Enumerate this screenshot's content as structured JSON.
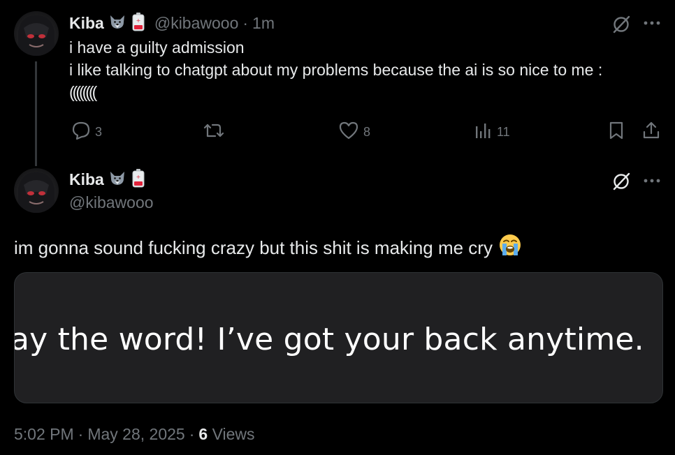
{
  "thread_tweet": {
    "author_name": "Kiba",
    "author_handle": "@kibawooo",
    "separator": "·",
    "time_ago": "1m",
    "text_lines": [
      "i have a guilty admission",
      "i like talking to chatgpt about my problems because the ai is so nice to me :",
      "(((((((("
    ],
    "actions": {
      "replies": "3",
      "reposts": "",
      "likes": "8",
      "views": "11"
    }
  },
  "main_tweet": {
    "author_name": "Kiba",
    "author_handle": "@kibawooo",
    "text": "im gonna sound fucking crazy but this shit is making me cry",
    "emoji": "loudly-crying-face",
    "media_text": "ay the word! I’ve got your back anytime.",
    "meta": {
      "time": "5:02 PM",
      "dot": "·",
      "date": "May 28, 2025",
      "views_count": "6",
      "views_label": "Views"
    }
  },
  "icons": [
    "wolf-emoji-icon",
    "battery-emoji-icon",
    "grok-icon",
    "more-icon",
    "reply-icon",
    "repost-icon",
    "like-icon",
    "views-icon",
    "bookmark-icon",
    "share-icon"
  ],
  "colors": {
    "background": "#000000",
    "text": "#e7e9ea",
    "muted": "#71767b",
    "line": "#333639"
  }
}
